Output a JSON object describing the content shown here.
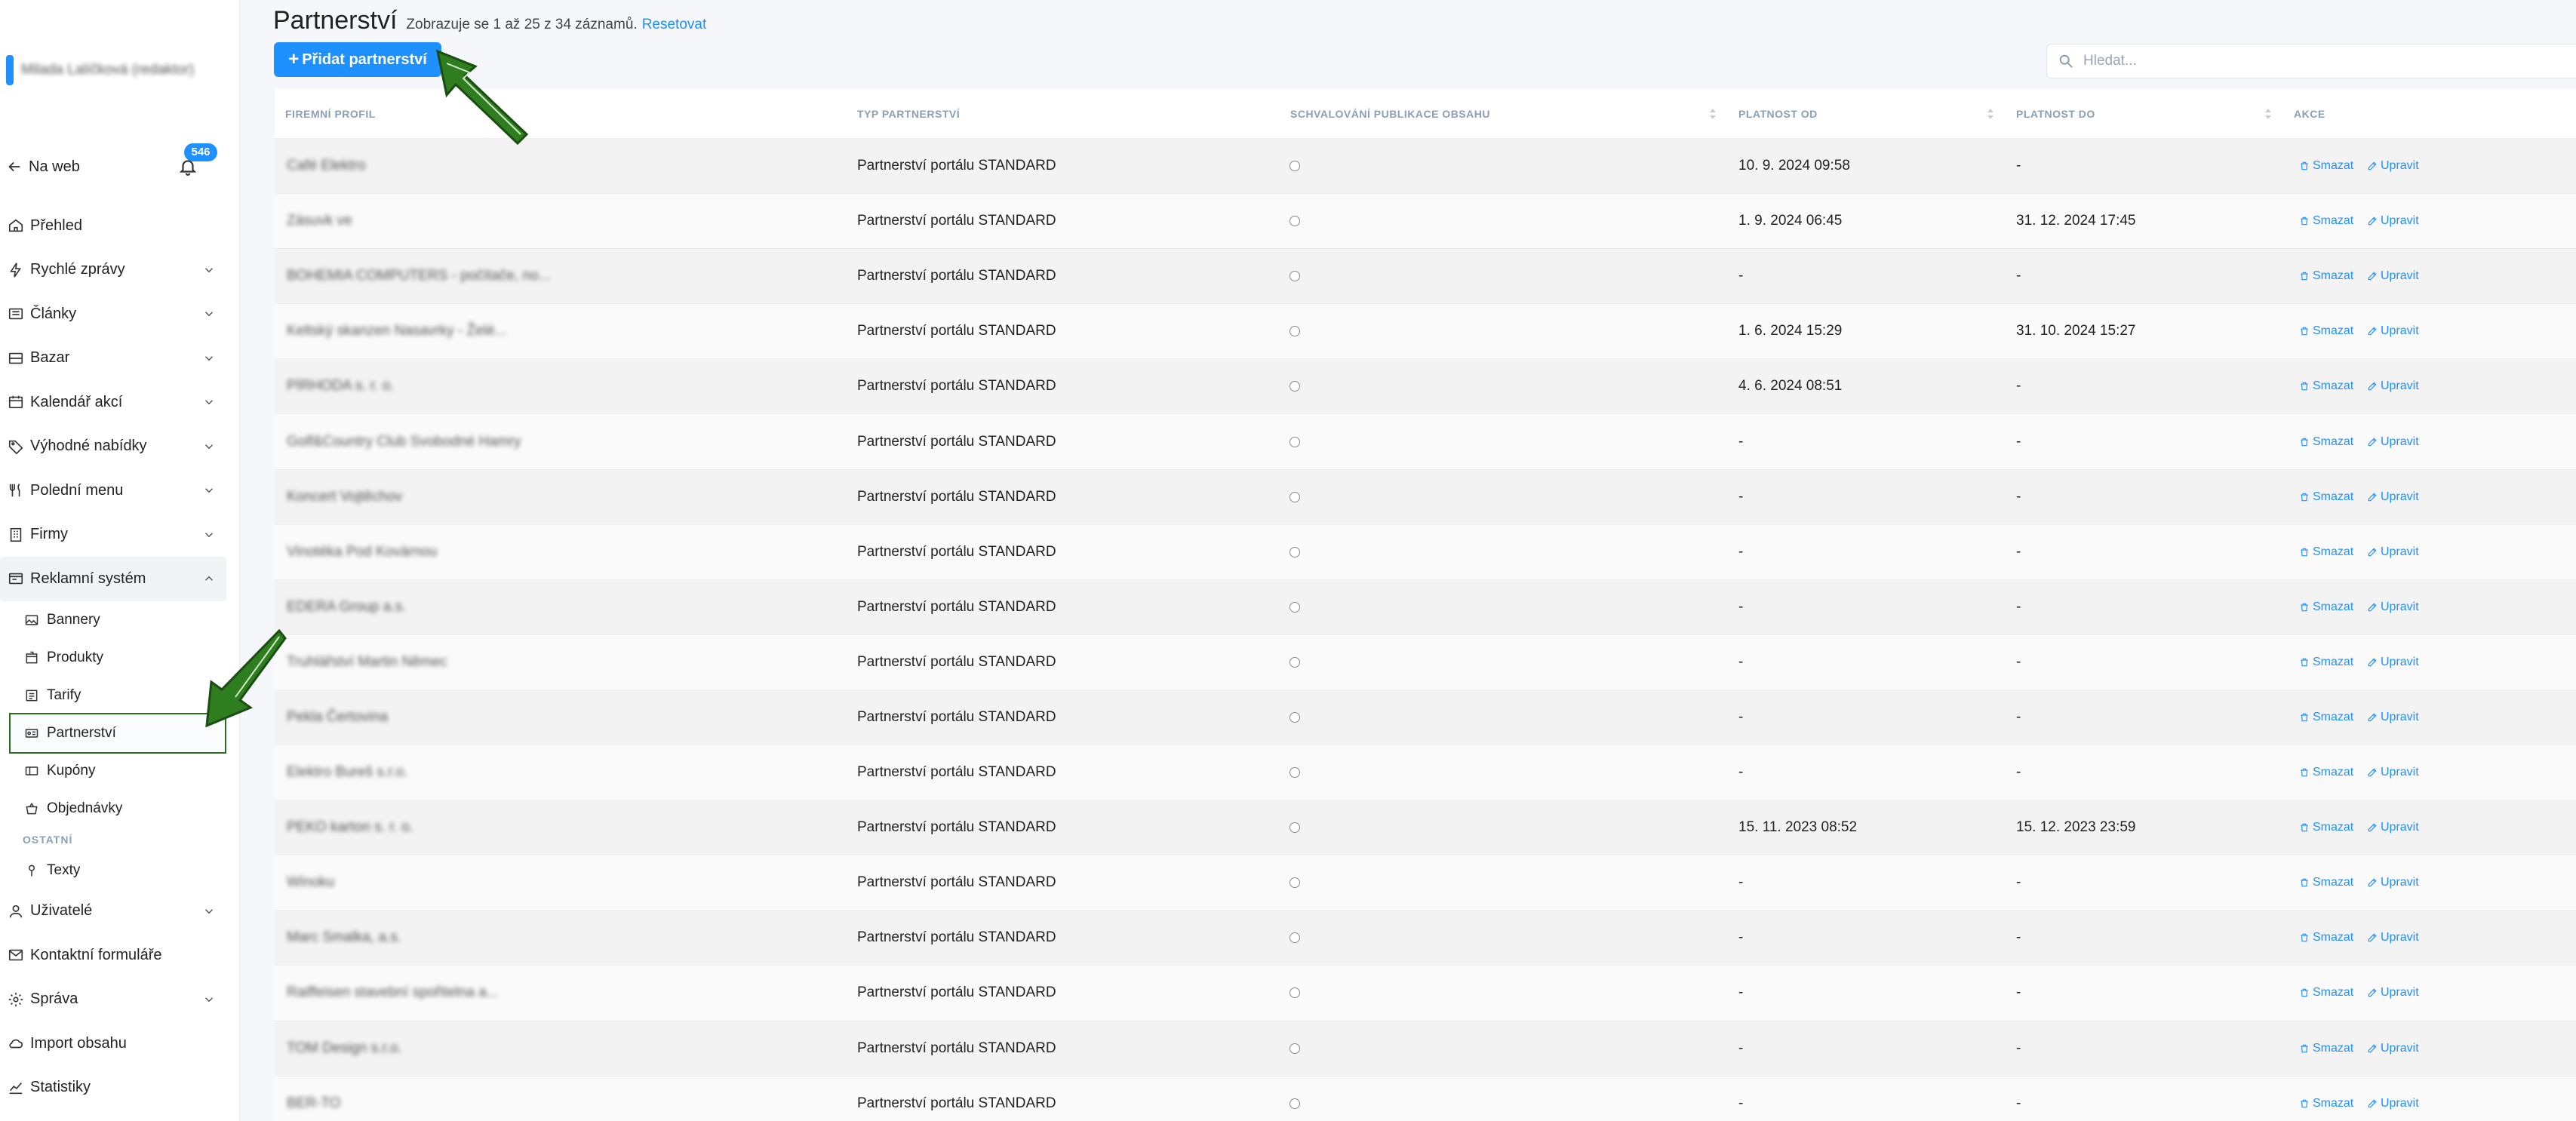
{
  "sidebar": {
    "user_name": "Milada Lalíčková (redaktor)",
    "back_label": "Na web",
    "notification_count": "546",
    "menu": [
      {
        "label": "Přehled",
        "icon": "home-icon",
        "has_chevron": false
      },
      {
        "label": "Rychlé zprávy",
        "icon": "bolt-icon",
        "has_chevron": true
      },
      {
        "label": "Články",
        "icon": "newspaper-icon",
        "has_chevron": true
      },
      {
        "label": "Bazar",
        "icon": "inbox-icon",
        "has_chevron": true
      },
      {
        "label": "Kalendář akcí",
        "icon": "calendar-icon",
        "has_chevron": true
      },
      {
        "label": "Výhodné nabídky",
        "icon": "tag-icon",
        "has_chevron": true
      },
      {
        "label": "Polední menu",
        "icon": "fork-knife-icon",
        "has_chevron": true
      },
      {
        "label": "Firmy",
        "icon": "building-icon",
        "has_chevron": true
      },
      {
        "label": "Reklamní systém",
        "icon": "ad-icon",
        "has_chevron": true
      }
    ],
    "submenu": [
      {
        "label": "Bannery",
        "icon": "image-icon"
      },
      {
        "label": "Produkty",
        "icon": "box-icon"
      },
      {
        "label": "Tarify",
        "icon": "list-icon"
      },
      {
        "label": "Partnerství",
        "icon": "id-card-icon"
      },
      {
        "label": "Kupóny",
        "icon": "coupon-icon"
      },
      {
        "label": "Objednávky",
        "icon": "basket-icon"
      }
    ],
    "section_label": "OSTATNÍ",
    "other_items": [
      {
        "label": "Texty",
        "icon": "pin-icon"
      }
    ],
    "bottom_menu": [
      {
        "label": "Uživatelé",
        "icon": "user-icon",
        "has_chevron": true
      },
      {
        "label": "Kontaktní formuláře",
        "icon": "mail-icon",
        "has_chevron": false
      },
      {
        "label": "Správa",
        "icon": "gear-icon",
        "has_chevron": true
      },
      {
        "label": "Import obsahu",
        "icon": "cloud-icon",
        "has_chevron": false
      },
      {
        "label": "Statistiky",
        "icon": "chart-icon",
        "has_chevron": false
      }
    ]
  },
  "header": {
    "title": "Partnerství",
    "records_info": "Zobrazuje se 1 až 25 z 34 záznamů.",
    "reset_label": "Resetovat",
    "add_button_label": "Přidat partnerství",
    "search_placeholder": "Hledat..."
  },
  "table": {
    "columns": [
      "FIREMNÍ PROFIL",
      "TYP PARTNERSTVÍ",
      "SCHVALOVÁNÍ PUBLIKACE OBSAHU",
      "PLATNOST OD",
      "PLATNOST DO",
      "AKCE"
    ],
    "delete_label": "Smazat",
    "edit_label": "Upravit",
    "rows": [
      {
        "profile": "Café Elektro",
        "type": "Partnerství portálu STANDARD",
        "from": "10. 9. 2024 09:58",
        "to": "-"
      },
      {
        "profile": "Zásuvk ve",
        "type": "Partnerství portálu STANDARD",
        "from": "1. 9. 2024 06:45",
        "to": "31. 12. 2024 17:45"
      },
      {
        "profile": "BOHEMIA COMPUTERS - počítače, no...",
        "type": "Partnerství portálu STANDARD",
        "from": "-",
        "to": "-"
      },
      {
        "profile": "Keltský skanzen Nasavrky - Želé...",
        "type": "Partnerství portálu STANDARD",
        "from": "1. 6. 2024 15:29",
        "to": "31. 10. 2024 15:27"
      },
      {
        "profile": "PÍRHODA s. r. o.",
        "type": "Partnerství portálu STANDARD",
        "from": "4. 6. 2024 08:51",
        "to": "-"
      },
      {
        "profile": "Golf&Country Club Svobodné Hamry",
        "type": "Partnerství portálu STANDARD",
        "from": "-",
        "to": "-"
      },
      {
        "profile": "Koncert Vojtěchov",
        "type": "Partnerství portálu STANDARD",
        "from": "-",
        "to": "-"
      },
      {
        "profile": "Vinotéka Pod Kovárnou",
        "type": "Partnerství portálu STANDARD",
        "from": "-",
        "to": "-"
      },
      {
        "profile": "EDERA Group a.s.",
        "type": "Partnerství portálu STANDARD",
        "from": "-",
        "to": "-"
      },
      {
        "profile": "Truhlářství Martin Němec",
        "type": "Partnerství portálu STANDARD",
        "from": "-",
        "to": "-"
      },
      {
        "profile": "Pekla Čertovina",
        "type": "Partnerství portálu STANDARD",
        "from": "-",
        "to": "-"
      },
      {
        "profile": "Elektro Bureš s.r.o.",
        "type": "Partnerství portálu STANDARD",
        "from": "-",
        "to": "-"
      },
      {
        "profile": "PEKO karton s. r. o.",
        "type": "Partnerství portálu STANDARD",
        "from": "15. 11. 2023 08:52",
        "to": "15. 12. 2023 23:59"
      },
      {
        "profile": "Winoku",
        "type": "Partnerství portálu STANDARD",
        "from": "-",
        "to": "-"
      },
      {
        "profile": "Marc Smalka, a.s.",
        "type": "Partnerství portálu STANDARD",
        "from": "-",
        "to": "-"
      },
      {
        "profile": "Raiffeisen stavební spořitelna a...",
        "type": "Partnerství portálu STANDARD",
        "from": "-",
        "to": "-"
      },
      {
        "profile": "TOM Design s.r.o.",
        "type": "Partnerství portálu STANDARD",
        "from": "-",
        "to": "-"
      },
      {
        "profile": "BER-TO",
        "type": "Partnerství portálu STANDARD",
        "from": "-",
        "to": "-"
      }
    ]
  },
  "colors": {
    "accent": "#1e90ff",
    "annotation_arrow": "#2e7d1f"
  }
}
